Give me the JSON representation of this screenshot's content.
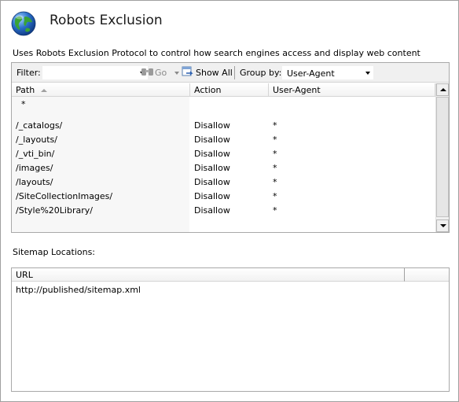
{
  "header": {
    "title": "Robots Exclusion",
    "description": "Uses Robots Exclusion Protocol to control how search engines access and display web content"
  },
  "toolbar": {
    "filter_label": "Filter:",
    "filter_value": "",
    "go_label": "Go",
    "show_all_label": "Show All",
    "group_by_label": "Group by:",
    "group_by_value": "User-Agent"
  },
  "grid": {
    "columns": [
      "Path",
      "Action",
      "User-Agent"
    ],
    "group_header": "*",
    "rows": [
      {
        "path": "/_catalogs/",
        "action": "Disallow",
        "user_agent": "*"
      },
      {
        "path": "/_layouts/",
        "action": "Disallow",
        "user_agent": "*"
      },
      {
        "path": "/_vti_bin/",
        "action": "Disallow",
        "user_agent": "*"
      },
      {
        "path": "/images/",
        "action": "Disallow",
        "user_agent": "*"
      },
      {
        "path": "/layouts/",
        "action": "Disallow",
        "user_agent": "*"
      },
      {
        "path": "/SiteCollectionImages/",
        "action": "Disallow",
        "user_agent": "*"
      },
      {
        "path": "/Style%20Library/",
        "action": "Disallow",
        "user_agent": "*"
      }
    ]
  },
  "sitemap": {
    "label": "Sitemap Locations:",
    "column": "URL",
    "items": [
      "http://published/sitemap.xml"
    ]
  },
  "colors": {
    "toolbar_bg": "#f0f0f0",
    "path_column_bg": "#f7f7f7",
    "border": "#a9a9a9",
    "globe_blue": "#2a6fc9",
    "globe_green": "#3aa335"
  }
}
